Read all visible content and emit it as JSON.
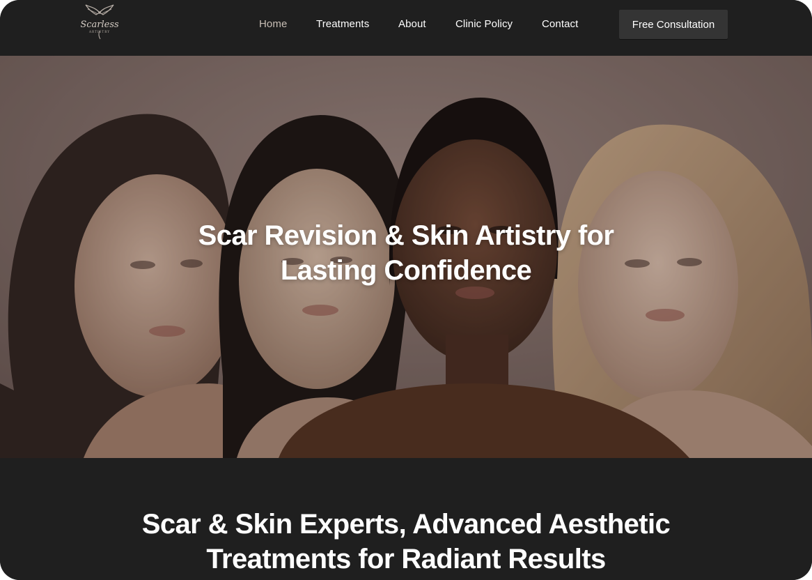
{
  "brand": {
    "name": "Scarless",
    "tagline": "ARTISTRY"
  },
  "nav": {
    "items": [
      {
        "label": "Home",
        "active": true
      },
      {
        "label": "Treatments",
        "active": false
      },
      {
        "label": "About",
        "active": false
      },
      {
        "label": "Clinic Policy",
        "active": false
      },
      {
        "label": "Contact",
        "active": false
      }
    ],
    "cta_label": "Free Consultation"
  },
  "hero": {
    "title_line1": "Scar Revision & Skin Artistry for",
    "title_line2": "Lasting Confidence",
    "image_subject": "four women with glowing skin posed together"
  },
  "section": {
    "title_line1": "Scar & Skin Experts, Advanced Aesthetic",
    "title_line2": "Treatments for Radiant Results"
  },
  "colors": {
    "background_dark": "#1f1f1f",
    "button_bg": "#343434",
    "nav_active": "#c9bfb6",
    "text": "#ffffff"
  }
}
